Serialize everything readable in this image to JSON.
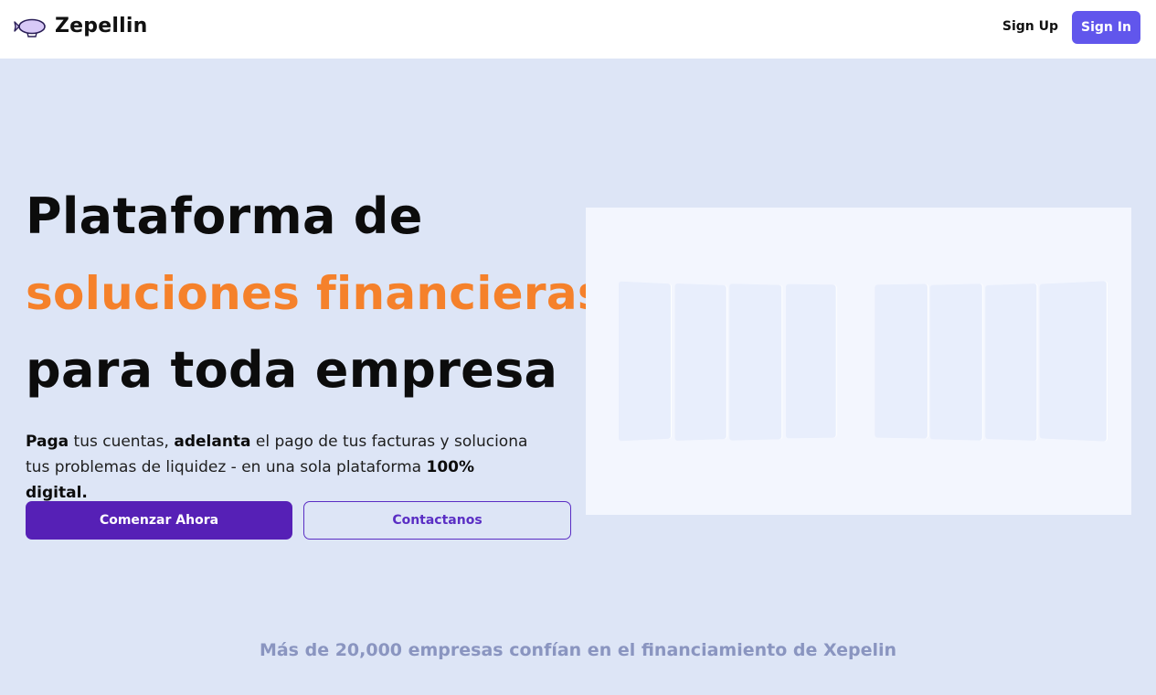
{
  "header": {
    "brand": "Zepellin",
    "logo_icon": "zeppelin-icon",
    "signup_label": "Sign Up",
    "signin_label": "Sign In"
  },
  "hero": {
    "headline_line1": "Plataforma de",
    "headline_line2": "soluciones financieras",
    "headline_line3": "para toda empresa",
    "lead_bold_1": "Paga",
    "lead_text_1": " tus cuentas, ",
    "lead_bold_2": "adelanta",
    "lead_text_2": " el pago de tus facturas y soluciona tus problemas de liquidez - en una sola plataforma ",
    "lead_bold_3": "100% digital.",
    "primary_cta": "Comenzar Ahora",
    "secondary_cta": "Contactanos"
  },
  "trust_line": "Más de 20,000 empresas confían en el financiamiento de Xepelin",
  "colors": {
    "accent_orange": "#f5812b",
    "primary_purple": "#5620b6",
    "signin_blue": "#6156ec",
    "page_bg": "#dde5f6"
  }
}
